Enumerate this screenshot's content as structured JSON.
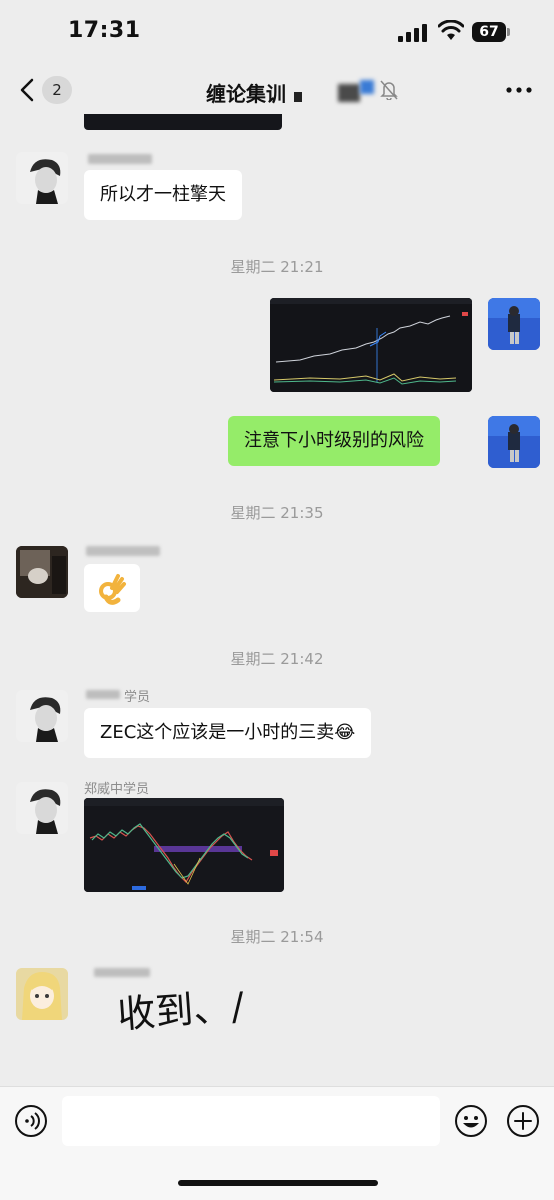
{
  "status_bar": {
    "time": "17:31",
    "battery": "67"
  },
  "nav": {
    "unread_count": "2",
    "title": "缠论集训"
  },
  "messages": [
    {
      "text": "所以才一柱擎天"
    },
    {
      "time": "星期二 21:21"
    },
    {
      "text": "注意下小时级别的风险"
    },
    {
      "time": "星期二 21:35"
    },
    {
      "time": "星期二 21:42"
    },
    {
      "sender_suffix": "学员",
      "text": "ZEC这个应该是一小时的三卖😂"
    },
    {
      "sender": "郑威中学员"
    },
    {
      "time": "星期二 21:54"
    },
    {
      "handwriting": "收到、/"
    }
  ]
}
